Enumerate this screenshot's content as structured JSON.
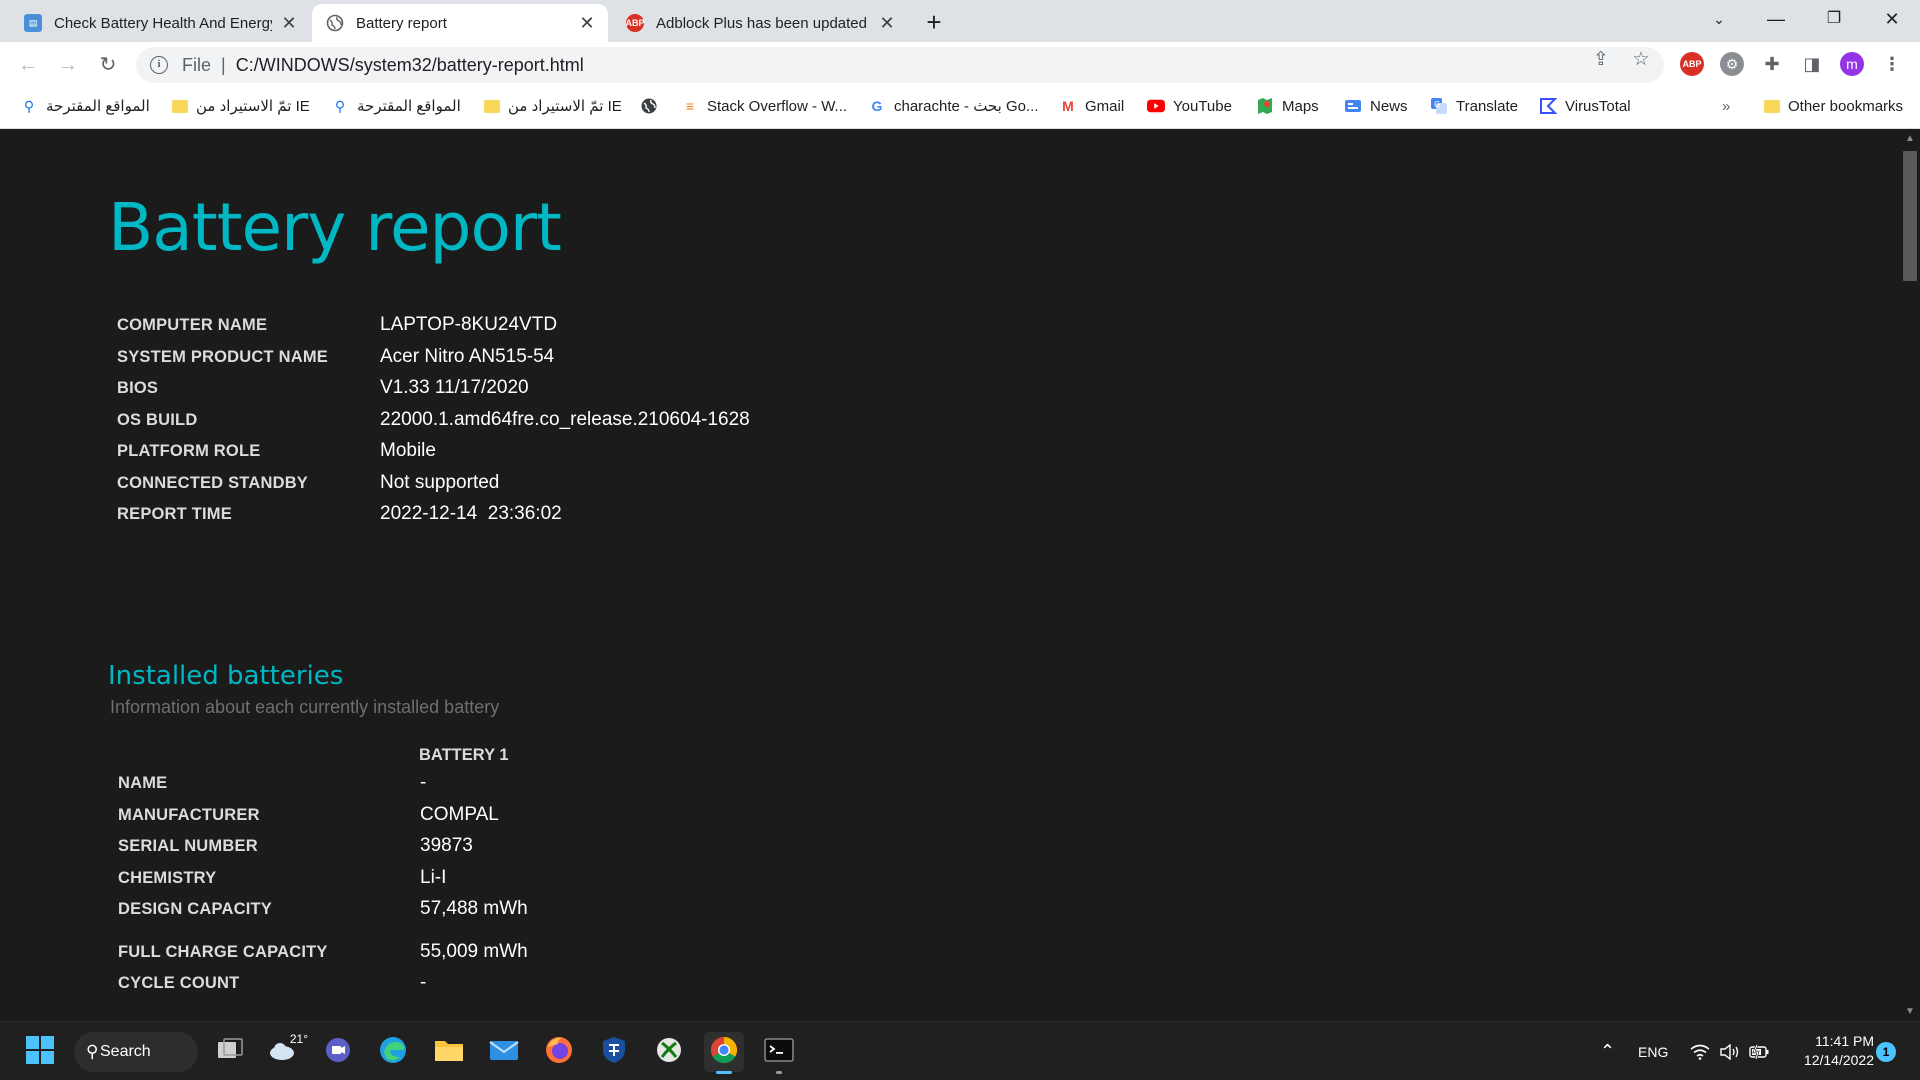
{
  "browser": {
    "tabs": [
      {
        "title": "Check Battery Health And Energy",
        "active": false
      },
      {
        "title": "Battery report",
        "active": true
      },
      {
        "title": "Adblock Plus has been updated",
        "active": false
      }
    ],
    "url_scheme_chip": "File",
    "url": "C:/WINDOWS/system32/battery-report.html",
    "profile_initial": "m",
    "adblock_badge": "ABP"
  },
  "bookmarks": {
    "items": [
      {
        "label": "المواقع المقترحة",
        "icon": "search-icon"
      },
      {
        "label": "تمّ الاستيراد من IE",
        "icon": "folder-icon"
      },
      {
        "label": "المواقع المقترحة",
        "icon": "search-icon"
      },
      {
        "label": "تمّ الاستيراد من IE",
        "icon": "folder-icon"
      },
      {
        "label": "",
        "icon": "globe-icon"
      },
      {
        "label": "Stack Overflow - W...",
        "icon": "stackoverflow-icon"
      },
      {
        "label": "charachte - بحث Go...",
        "icon": "google-icon"
      },
      {
        "label": "Gmail",
        "icon": "gmail-icon"
      },
      {
        "label": "YouTube",
        "icon": "youtube-icon"
      },
      {
        "label": "Maps",
        "icon": "maps-icon"
      },
      {
        "label": "News",
        "icon": "news-icon"
      },
      {
        "label": "Translate",
        "icon": "translate-icon"
      },
      {
        "label": "VirusTotal",
        "icon": "virustotal-icon"
      }
    ],
    "overflow": "»",
    "other": "Other bookmarks"
  },
  "report": {
    "title": "Battery report",
    "system_info": [
      {
        "label": "COMPUTER NAME",
        "value": "LAPTOP-8KU24VTD"
      },
      {
        "label": "SYSTEM PRODUCT NAME",
        "value": "Acer Nitro AN515-54"
      },
      {
        "label": "BIOS",
        "value": "V1.33 11/17/2020"
      },
      {
        "label": "OS BUILD",
        "value": "22000.1.amd64fre.co_release.210604-1628"
      },
      {
        "label": "PLATFORM ROLE",
        "value": "Mobile"
      },
      {
        "label": "CONNECTED STANDBY",
        "value": "Not supported"
      },
      {
        "label": "REPORT TIME",
        "value": "2022-12-14  23:36:02"
      }
    ],
    "installed": {
      "heading": "Installed batteries",
      "subtitle": "Information about each currently installed battery",
      "column": "BATTERY 1",
      "rows": [
        {
          "label": "NAME",
          "value": "-"
        },
        {
          "label": "MANUFACTURER",
          "value": "COMPAL"
        },
        {
          "label": "SERIAL NUMBER",
          "value": "39873"
        },
        {
          "label": "CHEMISTRY",
          "value": "Li-I"
        },
        {
          "label": "DESIGN CAPACITY",
          "value": "57,488 mWh"
        },
        {
          "label": "FULL CHARGE CAPACITY",
          "value": "55,009 mWh"
        },
        {
          "label": "CYCLE COUNT",
          "value": "-"
        }
      ]
    }
  },
  "taskbar": {
    "search_label": "Search",
    "weather_temp": "21°",
    "language": "ENG",
    "time": "11:41 PM",
    "date": "12/14/2022",
    "notification_count": "1"
  },
  "colors": {
    "accent": "#00b7c3",
    "page_bg": "#1b1b1b",
    "taskbar_bg": "#202020"
  }
}
